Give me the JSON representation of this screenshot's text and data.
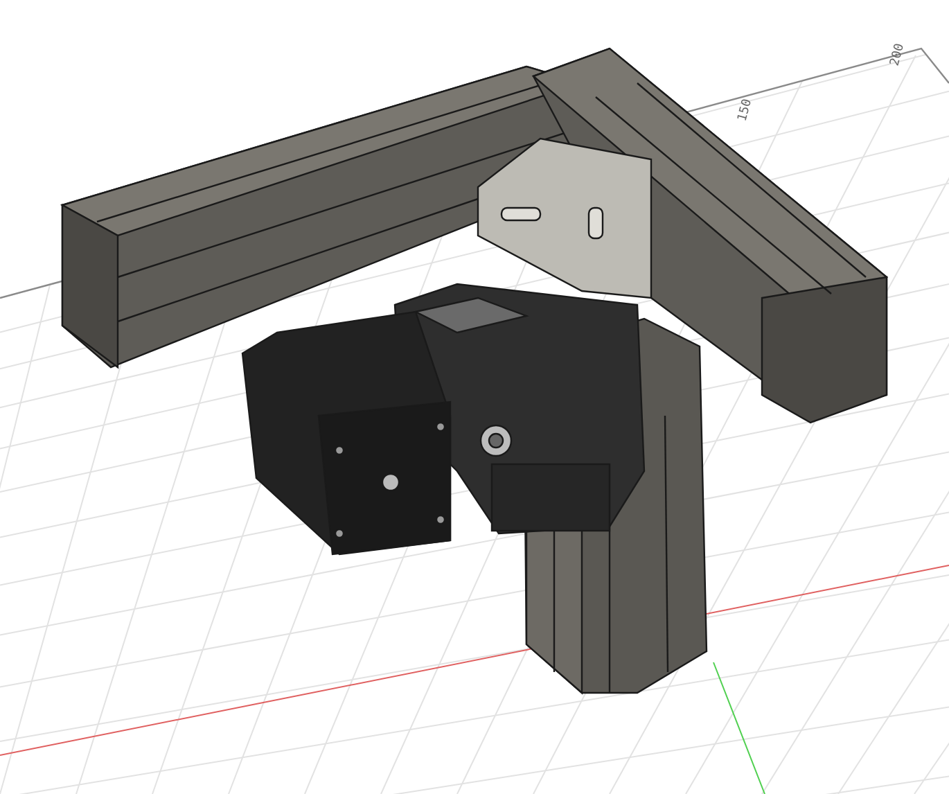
{
  "viewport": {
    "grid_labels": [
      "150",
      "200"
    ]
  }
}
